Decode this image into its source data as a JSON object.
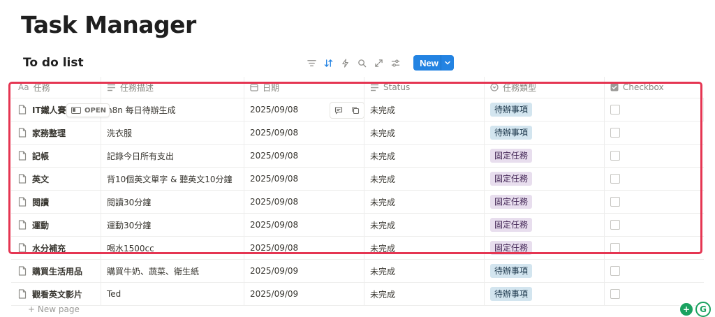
{
  "page": {
    "title": "Task Manager"
  },
  "view": {
    "title": "To do list"
  },
  "toolbar": {
    "icons": [
      "filter-icon",
      "sort-icon",
      "automation-icon",
      "search-icon",
      "expand-icon",
      "settings-icon"
    ],
    "new_label": "New"
  },
  "columns": [
    "任務",
    "任務描述",
    "日期",
    "Status",
    "任務類型",
    "Checkbox"
  ],
  "header_icons": {
    "name": "Aa"
  },
  "open_label": "OPEN",
  "rows": [
    {
      "name": "IT鐵人賽",
      "desc": "n8n 每日待辦生成",
      "date": "2025/09/08",
      "status": "未完成",
      "type": "待辦事項",
      "checked": false
    },
    {
      "name": "家務整理",
      "desc": "洗衣服",
      "date": "2025/09/08",
      "status": "未完成",
      "type": "待辦事項",
      "checked": false
    },
    {
      "name": "記帳",
      "desc": "記錄今日所有支出",
      "date": "2025/09/08",
      "status": "未完成",
      "type": "固定任務",
      "checked": false
    },
    {
      "name": "英文",
      "desc": "背10個英文單字 & 聽英文10分鐘",
      "date": "2025/09/08",
      "status": "未完成",
      "type": "固定任務",
      "checked": false
    },
    {
      "name": "閱讀",
      "desc": "閱讀30分鐘",
      "date": "2025/09/08",
      "status": "未完成",
      "type": "固定任務",
      "checked": false
    },
    {
      "name": "運動",
      "desc": "運動30分鐘",
      "date": "2025/09/08",
      "status": "未完成",
      "type": "固定任務",
      "checked": false
    },
    {
      "name": "水分補充",
      "desc": "喝水1500cc",
      "date": "2025/09/08",
      "status": "未完成",
      "type": "固定任務",
      "checked": false
    },
    {
      "name": "購買生活用品",
      "desc": "購買牛奶、蔬菜、衛生紙",
      "date": "2025/09/09",
      "status": "未完成",
      "type": "待辦事項",
      "checked": false
    },
    {
      "name": "觀看英文影片",
      "desc": "Ted",
      "date": "2025/09/09",
      "status": "未完成",
      "type": "待辦事項",
      "checked": false
    }
  ],
  "tag_colors": {
    "待辦事項": {
      "bg": "#d3e5ef",
      "fg": "#183347"
    },
    "固定任務": {
      "bg": "#e8deee",
      "fg": "#412454"
    }
  },
  "new_page_label": "New page",
  "accent": "#2383e2",
  "highlight_color": "#e53552"
}
